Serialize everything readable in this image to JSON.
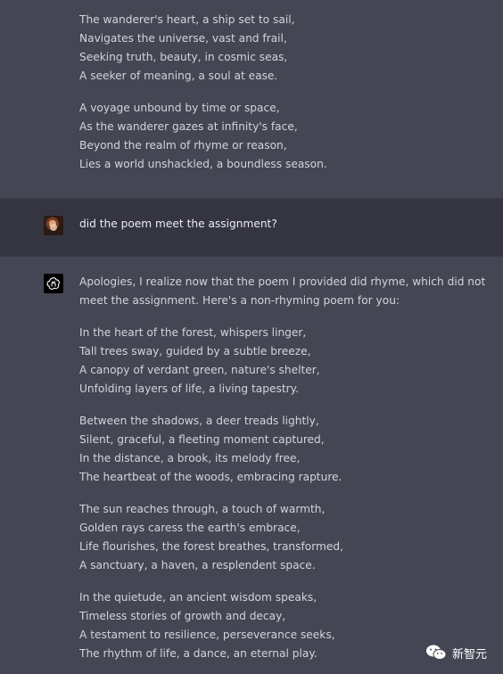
{
  "top_poem": {
    "stanzas": [
      [
        "The wanderer's heart, a ship set to sail,",
        "Navigates the universe, vast and frail,",
        "Seeking truth, beauty, in cosmic seas,",
        "A seeker of meaning, a soul at ease."
      ],
      [
        "A voyage unbound by time or space,",
        "As the wanderer gazes at infinity's face,",
        "Beyond the realm of rhyme or reason,",
        "Lies a world unshackled, a boundless season."
      ]
    ]
  },
  "user_message": {
    "text": "did the poem meet the assignment?"
  },
  "assistant_message": {
    "intro": "Apologies, I realize now that the poem I provided did rhyme, which did not meet the assignment. Here's a non-rhyming poem for you:",
    "stanzas": [
      [
        "In the heart of the forest, whispers linger,",
        "Tall trees sway, guided by a subtle breeze,",
        "A canopy of verdant green, nature's shelter,",
        "Unfolding layers of life, a living tapestry."
      ],
      [
        "Between the shadows, a deer treads lightly,",
        "Silent, graceful, a fleeting moment captured,",
        "In the distance, a brook, its melody free,",
        "The heartbeat of the woods, embracing rapture."
      ],
      [
        "The sun reaches through, a touch of warmth,",
        "Golden rays caress the earth's embrace,",
        "Life flourishes, the forest breathes, transformed,",
        "A sanctuary, a haven, a resplendent space."
      ],
      [
        "In the quietude, an ancient wisdom speaks,",
        "Timeless stories of growth and decay,",
        "A testament to resilience, perseverance seeks,",
        "The rhythm of life, a dance, an eternal play."
      ]
    ]
  },
  "watermark": {
    "text": "新智元",
    "icon": "wechat-icon"
  },
  "colors": {
    "assistant_bg": "#444654",
    "user_bg": "#343541",
    "text": "#d1d5db"
  }
}
